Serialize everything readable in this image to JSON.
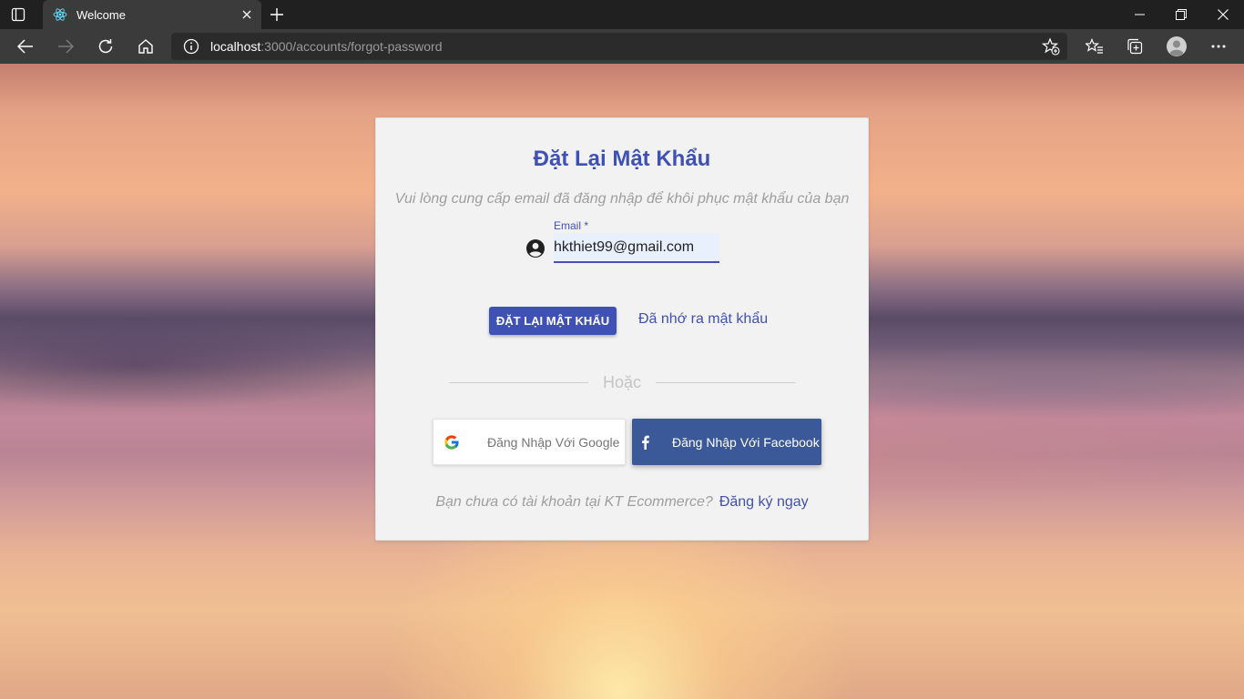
{
  "browser": {
    "tab_title": "Welcome",
    "url_host": "localhost",
    "url_path": ":3000/accounts/forgot-password"
  },
  "icons": {
    "tab_actions": "tab-actions-icon",
    "favicon": "react-icon",
    "tab_close": "close-icon",
    "new_tab": "plus-icon",
    "back": "back-arrow-icon",
    "forward": "forward-arrow-icon",
    "refresh": "refresh-icon",
    "home": "home-icon",
    "site_info": "info-icon",
    "add_favorite": "star-add-icon",
    "favorites": "favorites-icon",
    "collections": "collections-icon",
    "profile": "profile-icon",
    "menu": "more-icon",
    "minimize": "minimize-icon",
    "restore": "restore-icon",
    "close_window": "close-icon",
    "email_field": "account-circle-icon",
    "google": "google-g-icon",
    "facebook": "facebook-f-icon"
  },
  "colors": {
    "primary": "#3f51b5",
    "facebook": "#3b5998",
    "card_bg": "#f2f2f2"
  },
  "form": {
    "title": "Đặt Lại Mật Khẩu",
    "subtitle": "Vui lòng cung cấp email đã đăng nhập để khôi phục mật khẩu của bạn",
    "email_label": "Email *",
    "email_value": "hkthiet99@gmail.com",
    "reset_button": "ĐẶT LẠI MẬT KHẨU",
    "remember_link": "Đã nhớ ra mật khẩu",
    "divider_text": "Hoặc",
    "google_button": "Đăng Nhập Với Google",
    "facebook_button": "Đăng Nhập Với Facebook",
    "signup_question": "Bạn chưa có tài khoản tại KT Ecommerce?",
    "signup_link": "Đăng ký ngay"
  }
}
